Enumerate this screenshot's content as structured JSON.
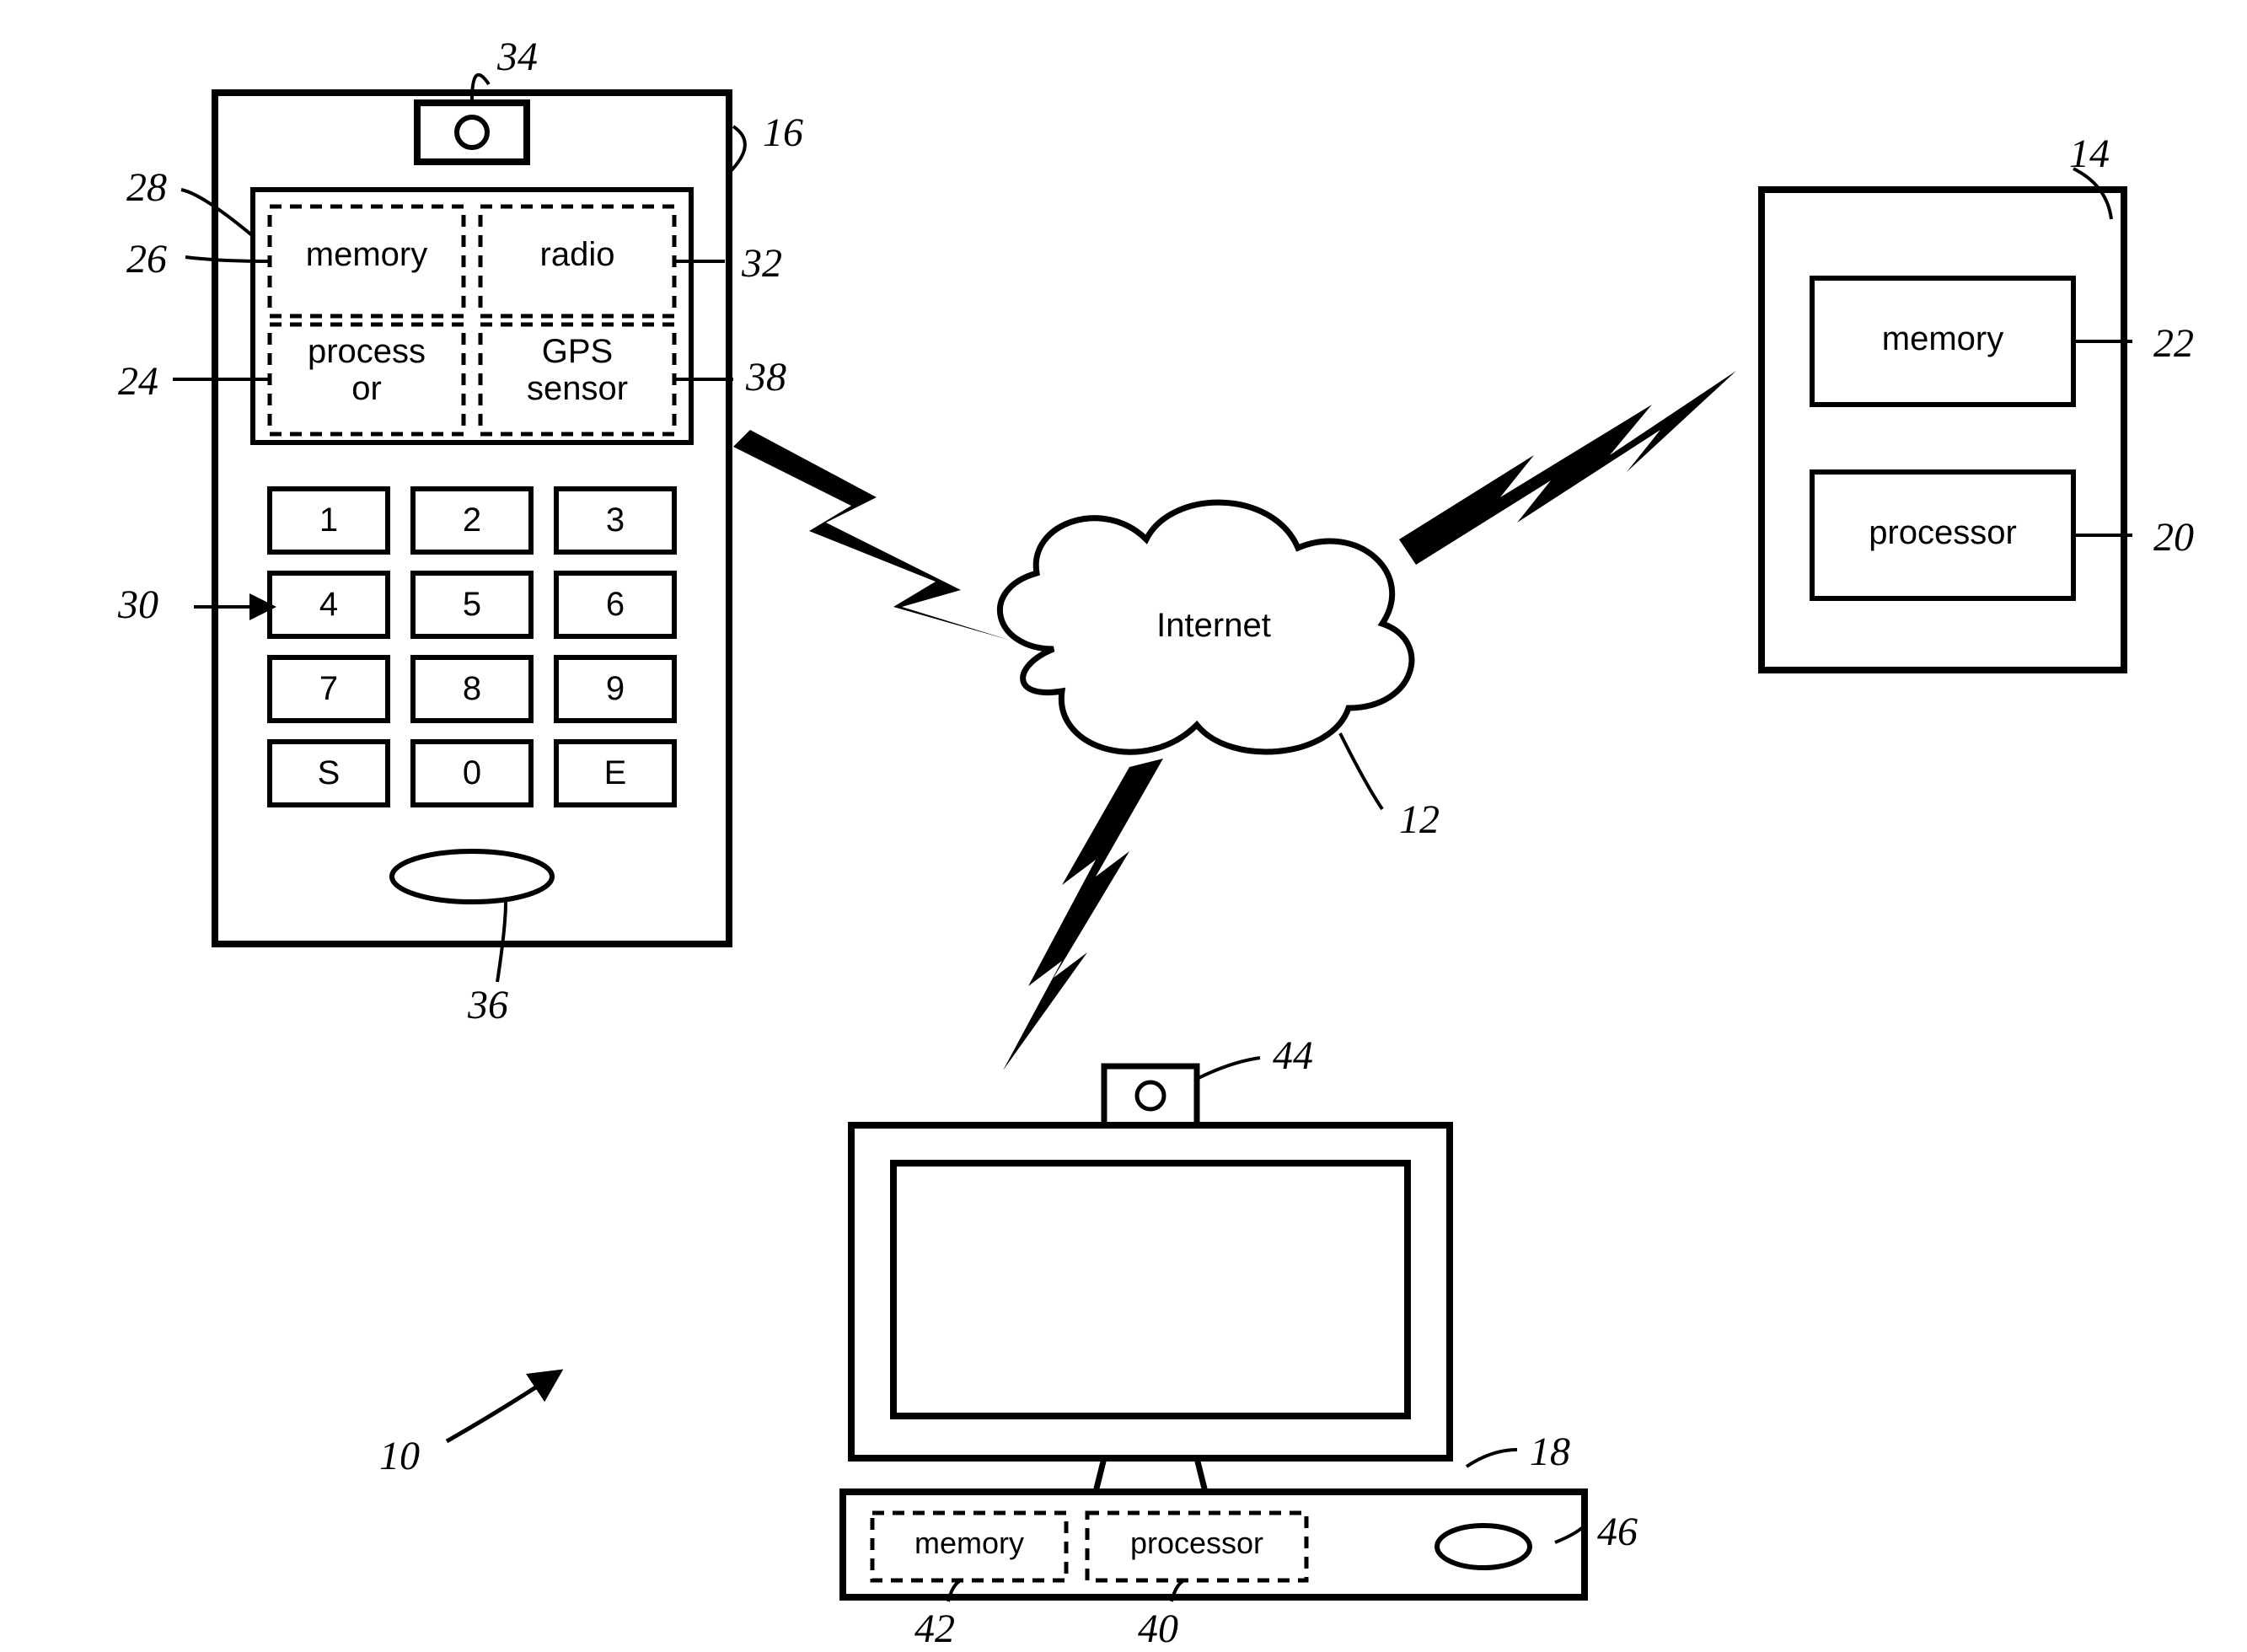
{
  "phone": {
    "ref": "16",
    "camera_ref": "34",
    "screen_ref": "28",
    "memory": {
      "label": "memory",
      "ref": "26"
    },
    "radio": {
      "label": "radio",
      "ref": "32"
    },
    "processor": {
      "label": "processor",
      "ref": "24"
    },
    "gps": {
      "label": "GPS sensor",
      "ref": "38"
    },
    "keypad_ref": "30",
    "keys": [
      "1",
      "2",
      "3",
      "4",
      "5",
      "6",
      "7",
      "8",
      "9",
      "S",
      "0",
      "E"
    ],
    "mic_ref": "36"
  },
  "cloud": {
    "label": "Internet",
    "ref": "12"
  },
  "server": {
    "ref": "14",
    "memory": {
      "label": "memory",
      "ref": "22"
    },
    "processor": {
      "label": "processor",
      "ref": "20"
    }
  },
  "pc": {
    "ref": "18",
    "camera_ref": "44",
    "memory": {
      "label": "memory",
      "ref": "42"
    },
    "processor": {
      "label": "processor",
      "ref": "40"
    },
    "drive_ref": "46"
  },
  "system_ref": "10"
}
